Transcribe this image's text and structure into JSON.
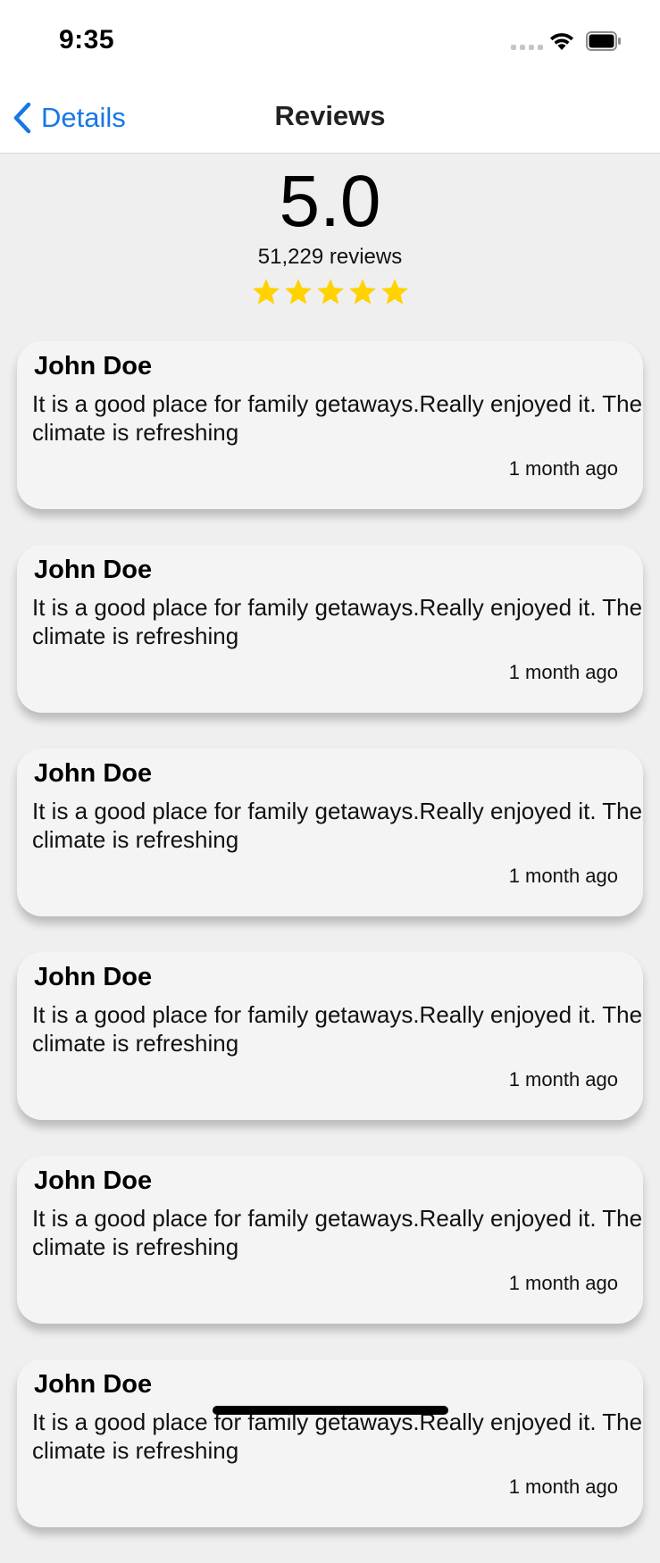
{
  "status_bar": {
    "time": "9:35",
    "icons": [
      "signal-dots-icon",
      "wifi-icon",
      "battery-icon"
    ]
  },
  "nav": {
    "back_label": "Details",
    "title": "Reviews",
    "accent_color": "#1677e7"
  },
  "summary": {
    "rating": "5.0",
    "reviews_count": "51,229 reviews",
    "stars_filled": 5,
    "stars_total": 5,
    "star_color": "#ffd200"
  },
  "reviews": [
    {
      "name": "John Doe",
      "text": " It is a good place for family getaways.Really enjoyed it. The climate is refreshing",
      "time": "1 month ago"
    },
    {
      "name": "John Doe",
      "text": " It is a good place for family getaways.Really enjoyed it. The climate is refreshing",
      "time": "1 month ago"
    },
    {
      "name": "John Doe",
      "text": " It is a good place for family getaways.Really enjoyed it. The climate is refreshing",
      "time": "1 month ago"
    },
    {
      "name": "John Doe",
      "text": " It is a good place for family getaways.Really enjoyed it. The climate is refreshing",
      "time": "1 month ago"
    },
    {
      "name": "John Doe",
      "text": " It is a good place for family getaways.Really enjoyed it. The climate is refreshing",
      "time": "1 month ago"
    },
    {
      "name": "John Doe",
      "text": " It is a good place for family getaways.Really enjoyed it. The climate is refreshing",
      "time": "1 month ago"
    }
  ]
}
